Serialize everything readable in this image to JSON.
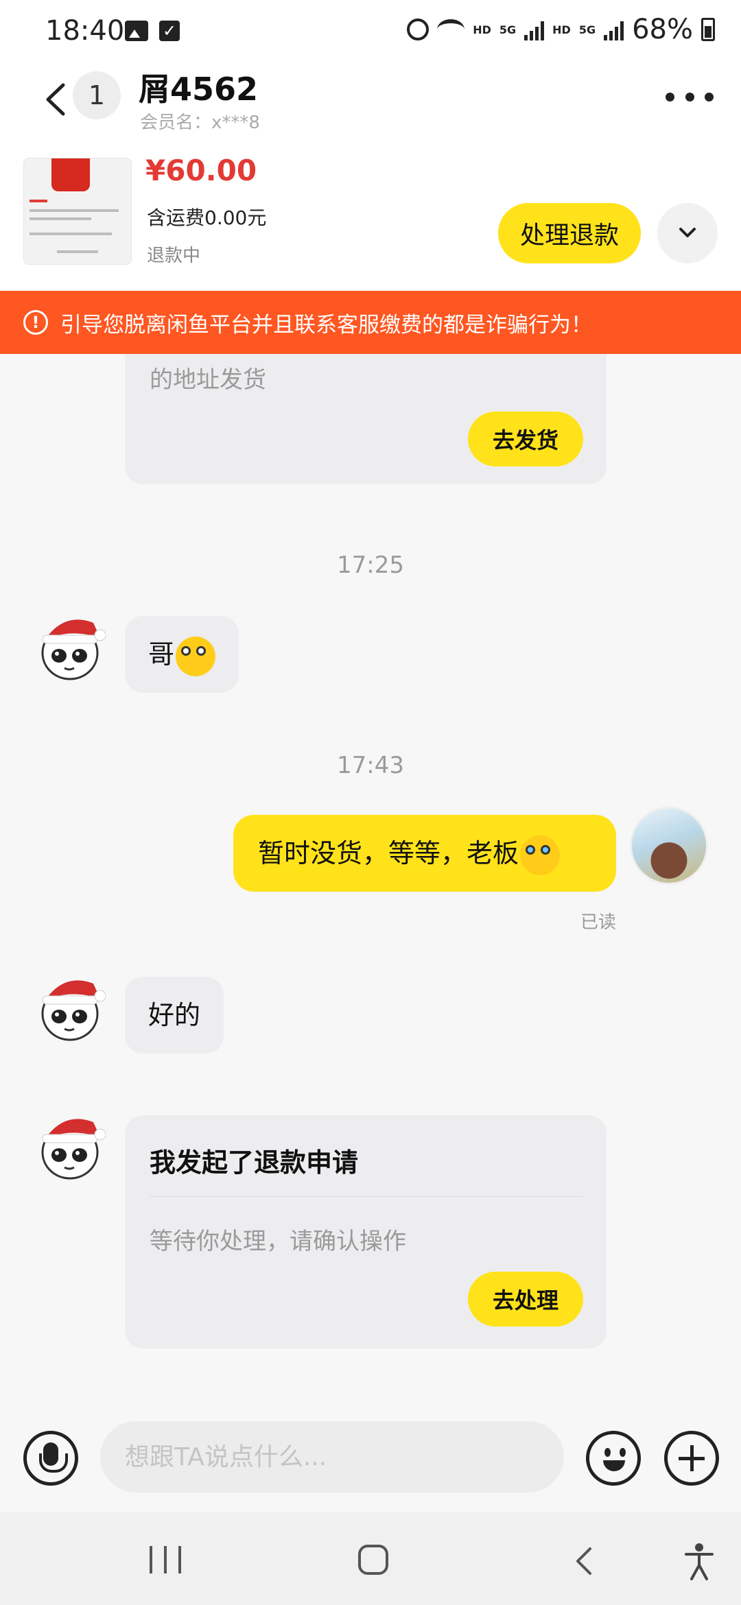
{
  "status_bar": {
    "time": "18:40",
    "battery_text": "68%",
    "network_tag_1": "HD",
    "network_tag_2": "HD",
    "network_type_1": "5G",
    "network_type_2": "5G",
    "icons": [
      "image-icon",
      "check-icon",
      "alarm-icon",
      "wifi-icon",
      "signal-icon",
      "battery-icon"
    ]
  },
  "header": {
    "unread_count": "1",
    "title": "屑4562",
    "member_name": "会员名：x***8",
    "more_icon": "more-dots-icon"
  },
  "product": {
    "price": "¥60.00",
    "shipping": "含运费0.00元",
    "status": "退款中",
    "refund_button": "处理退款"
  },
  "warning": {
    "text": "引导您脱离闲鱼平台并且联系客服缴费的都是诈骗行为！"
  },
  "messages": {
    "card1": {
      "desc": "的地址发货",
      "button": "去发货"
    },
    "time1": "17:25",
    "msg1": "哥",
    "time2": "17:43",
    "msg2": "暂时没货，等等，老板",
    "read_status": "已读",
    "msg3": "好的",
    "card2": {
      "title": "我发起了退款申请",
      "desc": "等待你处理，请确认操作",
      "button": "去处理"
    }
  },
  "input": {
    "placeholder": "想跟TA说点什么..."
  },
  "colors": {
    "accent_yellow": "#ffe21a",
    "warning_orange": "#ff5722",
    "price_red": "#e33a35"
  }
}
